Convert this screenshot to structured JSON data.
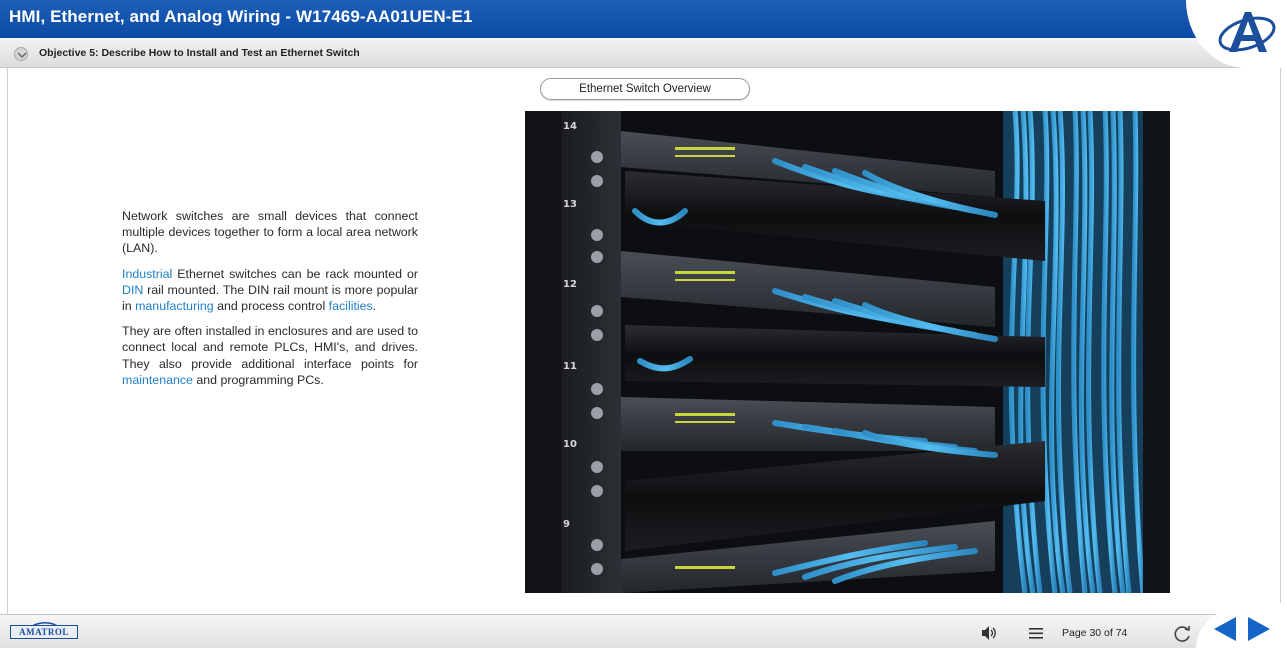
{
  "app": {
    "title": "HMI, Ethernet, and Analog Wiring - W17469-AA01UEN-E1",
    "objective": "Objective 5: Describe How to Install and Test an Ethernet Switch",
    "logo_icon": "amatrol-a-logo-icon"
  },
  "slide": {
    "section_title": "Ethernet Switch Overview",
    "paragraphs": [
      {
        "segments": [
          {
            "text": "Network switches are small devices that connect multiple devices together to form a local area network (LAN).",
            "link": false
          }
        ]
      },
      {
        "segments": [
          {
            "text": "Industrial",
            "link": true
          },
          {
            "text": " Ethernet switches can be rack mounted or ",
            "link": false
          },
          {
            "text": "DIN",
            "link": true
          },
          {
            "text": " rail mounted. The DIN rail mount is more popular in ",
            "link": false
          },
          {
            "text": "manufacturing",
            "link": true
          },
          {
            "text": " and process control ",
            "link": false
          },
          {
            "text": "facilities",
            "link": true
          },
          {
            "text": ".",
            "link": false
          }
        ]
      },
      {
        "segments": [
          {
            "text": "They are often installed in enclosures and are used to connect local and remote PLCs, HMI's, and drives. They also provide additional interface points for ",
            "link": false
          },
          {
            "text": "maintenance",
            "link": true
          },
          {
            "text": " and programming PCs.",
            "link": false
          }
        ]
      }
    ],
    "photo": {
      "subject": "network-rack-photo",
      "rack_unit_labels": [
        "14",
        "13",
        "12",
        "11",
        "10",
        "9"
      ]
    }
  },
  "footer": {
    "brand": "AMATROL",
    "page_label": "Page 30 of 74",
    "icons": [
      "speaker-icon",
      "menu-icon",
      "reload-icon",
      "prev-arrow-icon",
      "next-arrow-icon"
    ]
  },
  "colors": {
    "title_bar": "#0b4aa4",
    "link": "#1f7fc6",
    "nav_arrow": "#1565c8",
    "cable": "#3aa6dd"
  }
}
